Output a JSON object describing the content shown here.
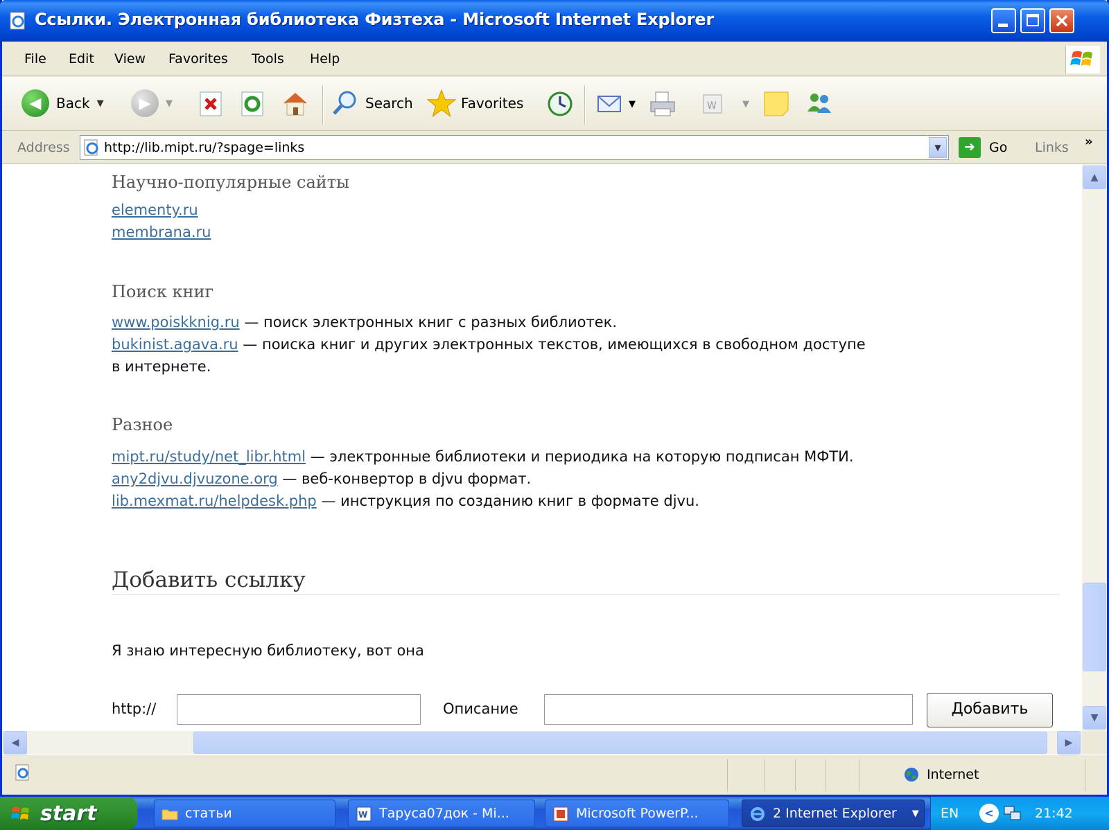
{
  "window": {
    "title": "Ссылки. Электронная библиотека Физтеха - Microsoft Internet Explorer"
  },
  "menu": [
    "File",
    "Edit",
    "View",
    "Favorites",
    "Tools",
    "Help"
  ],
  "toolbar": {
    "back_label": "Back",
    "search_label": "Search",
    "favorites_label": "Favorites"
  },
  "address": {
    "label": "Address",
    "url": "http://lib.mipt.ru/?spage=links",
    "go_label": "Go",
    "links_label": "Links"
  },
  "page": {
    "section_popular": "Научно-популярные сайты",
    "popular_links": [
      "elementy.ru",
      "membrana.ru"
    ],
    "section_books": "Поиск книг",
    "books": [
      {
        "link": "www.poiskknig.ru",
        "text": " — поиск электронных книг с разных библиотек."
      },
      {
        "link": "bukinist.agava.ru",
        "text": " — поиска книг и других электронных текстов, имеющихся в свободном доступе"
      }
    ],
    "books_continuation": "в интернете.",
    "section_misc": "Разное",
    "misc": [
      {
        "link": "mipt.ru/study/net_libr.html",
        "text": " — электронные библиотеки и периодика на которую подписан МФТИ."
      },
      {
        "link": "any2djvu.djvuzone.org",
        "text": " — веб-конвертор в djvu формат."
      },
      {
        "link": "lib.mexmat.ru/helpdesk.php",
        "text": " — инструкция по созданию книг в формате djvu."
      }
    ],
    "add_title": "Добавить ссылку",
    "add_intro": "Я знаю интересную библиотеку, вот она",
    "http_label": "http://",
    "desc_label": "Описание",
    "add_button": "Добавить",
    "http_value": "",
    "desc_value": ""
  },
  "status": {
    "zone": "Internet"
  },
  "taskbar": {
    "start": "start",
    "items": [
      "статьи",
      "Таруса07док - Mi...",
      "Microsoft PowerP...",
      "2 Internet Explorer"
    ],
    "lang": "EN",
    "clock": "21:42"
  }
}
